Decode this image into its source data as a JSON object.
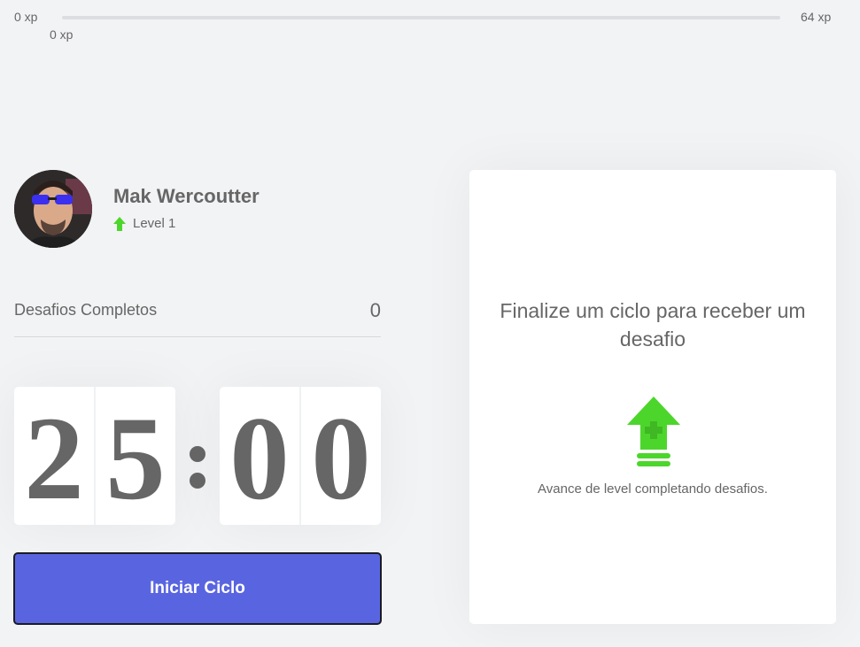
{
  "experience": {
    "min_label": "0 xp",
    "max_label": "64 xp",
    "current_label": "0 xp",
    "progress_fraction": 0
  },
  "profile": {
    "name": "Mak Wercoutter",
    "level_label": "Level 1",
    "avatar_alt": "Mak Wercoutter"
  },
  "challenges_completed": {
    "label": "Desafios Completos",
    "value": "0"
  },
  "countdown": {
    "minute_left": "2",
    "minute_right": "5",
    "second_left": "0",
    "second_right": "0"
  },
  "start_button": {
    "label": "Iniciar Ciclo"
  },
  "challenge_box": {
    "title": "Finalize um ciclo para receber um desafio",
    "hint": "Avance de level completando desafios.",
    "icon": "level-up-icon"
  },
  "colors": {
    "background": "#f2f3f5",
    "text": "#666666",
    "accent_green": "#4cd62b",
    "button_blue": "#5965e0"
  }
}
